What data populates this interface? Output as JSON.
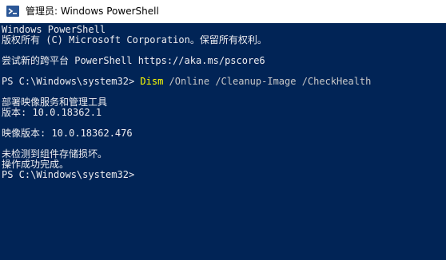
{
  "window": {
    "title": "管理员: Windows PowerShell"
  },
  "console": {
    "lines": [
      {
        "kind": "text",
        "text": "Windows PowerShell"
      },
      {
        "kind": "text",
        "text": "版权所有 (C) Microsoft Corporation。保留所有权利。"
      },
      {
        "kind": "blank"
      },
      {
        "kind": "text",
        "text": "尝试新的跨平台 PowerShell https://aka.ms/pscore6"
      },
      {
        "kind": "blank"
      },
      {
        "kind": "command",
        "prompt": "PS C:\\Windows\\system32> ",
        "command": "Dism",
        "args": " /Online /Cleanup-Image /CheckHealth"
      },
      {
        "kind": "blank"
      },
      {
        "kind": "text",
        "text": "部署映像服务和管理工具"
      },
      {
        "kind": "text",
        "text": "版本: 10.0.18362.1"
      },
      {
        "kind": "blank"
      },
      {
        "kind": "text",
        "text": "映像版本: 10.0.18362.476"
      },
      {
        "kind": "blank"
      },
      {
        "kind": "text",
        "text": "未检测到组件存储损坏。"
      },
      {
        "kind": "text",
        "text": "操作成功完成。"
      },
      {
        "kind": "prompt",
        "text": "PS C:\\Windows\\system32>"
      }
    ]
  },
  "colors": {
    "console_bg": "#012456",
    "console_fg": "#eeedf0",
    "command": "#ffff00",
    "args": "#c8c8c8"
  }
}
